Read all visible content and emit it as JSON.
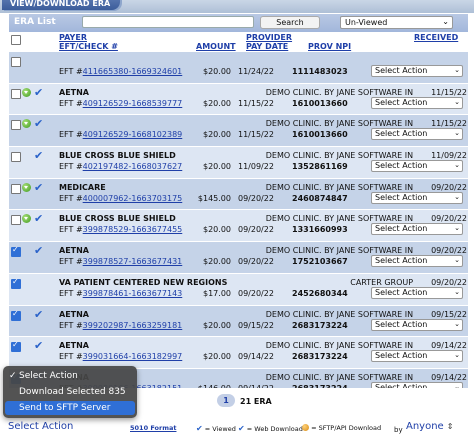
{
  "window": {
    "title": "VIEW/DOWNLOAD ERA"
  },
  "header": {
    "section_title": "ERA List",
    "search_value": "",
    "search_button": "Search",
    "filter_value": "Un-Viewed"
  },
  "columns": {
    "payer": "PAYER",
    "eft": "EFT/CHECK #",
    "amount": "AMOUNT",
    "provider": "PROVIDER",
    "pay_date": "PAY DATE",
    "npi": "PROV NPI",
    "received": "RECEIVED"
  },
  "rows": [
    {
      "payer": "",
      "eft_prefix": "EFT #",
      "eft": "411665380-1669324601",
      "amount": "$20.00",
      "pay_date": "11/24/22",
      "provider": "",
      "npi": "1111483023",
      "received": "",
      "action": "Select Action",
      "checked": false,
      "downloaded": false,
      "viewed": false
    },
    {
      "payer": "AETNA",
      "eft_prefix": "EFT #",
      "eft": "409126529-1668539777",
      "amount": "$20.00",
      "pay_date": "11/15/22",
      "provider": "DEMO CLINIC. BY JANE SOFTWARE IN",
      "npi": "1610013660",
      "received": "11/15/22",
      "action": "Select Action",
      "checked": false,
      "downloaded": true,
      "viewed": true
    },
    {
      "payer": "",
      "eft_prefix": "EFT #",
      "eft": "409126529-1668102389",
      "amount": "$20.00",
      "pay_date": "11/15/22",
      "provider": "DEMO CLINIC. BY JANE SOFTWARE IN",
      "npi": "1610013660",
      "received": "11/15/22",
      "action": "Select Action",
      "checked": false,
      "downloaded": true,
      "viewed": true
    },
    {
      "payer": "BLUE CROSS BLUE SHIELD",
      "eft_prefix": "EFT #",
      "eft": "402197482-1668037627",
      "amount": "$20.00",
      "pay_date": "11/09/22",
      "provider": "DEMO CLINIC. BY JANE SOFTWARE IN",
      "npi": "1352861169",
      "received": "11/09/22",
      "action": "Select Action",
      "checked": false,
      "downloaded": false,
      "viewed": true
    },
    {
      "payer": "MEDICARE",
      "eft_prefix": "EFT #",
      "eft": "400007962-1663703175",
      "amount": "$145.00",
      "pay_date": "09/20/22",
      "provider": "DEMO CLINIC. BY JANE SOFTWARE IN",
      "npi": "2460874847",
      "received": "09/20/22",
      "action": "Select Action",
      "checked": false,
      "downloaded": true,
      "viewed": true
    },
    {
      "payer": "BLUE CROSS BLUE SHIELD",
      "eft_prefix": "EFT #",
      "eft": "399878529-1663677455",
      "amount": "$20.00",
      "pay_date": "09/20/22",
      "provider": "DEMO CLINIC. BY JANE SOFTWARE IN",
      "npi": "1331660993",
      "received": "09/20/22",
      "action": "Select Action",
      "checked": false,
      "downloaded": true,
      "viewed": true
    },
    {
      "payer": "AETNA",
      "eft_prefix": "EFT #",
      "eft": "399878527-1663677431",
      "amount": "$20.00",
      "pay_date": "09/20/22",
      "provider": "DEMO CLINIC. BY JANE SOFTWARE IN",
      "npi": "1752103667",
      "received": "09/20/22",
      "action": "Select Action",
      "checked": true,
      "downloaded": false,
      "viewed": true
    },
    {
      "payer": "VA PATIENT CENTERED NEW REGIONS",
      "eft_prefix": "EFT #",
      "eft": "399878461-1663677143",
      "amount": "$17.00",
      "pay_date": "09/20/22",
      "provider": "CARTER GROUP",
      "npi": "2452680344",
      "received": "09/20/22",
      "action": "Select Action",
      "checked": true,
      "downloaded": false,
      "viewed": false
    },
    {
      "payer": "AETNA",
      "eft_prefix": "EFT #",
      "eft": "399202987-1663259181",
      "amount": "$20.00",
      "pay_date": "09/15/22",
      "provider": "DEMO CLINIC. BY JANE SOFTWARE IN",
      "npi": "2683173224",
      "received": "09/15/22",
      "action": "Select Action",
      "checked": true,
      "downloaded": false,
      "viewed": true
    },
    {
      "payer": "AETNA",
      "eft_prefix": "EFT #",
      "eft": "399031664-1663182997",
      "amount": "$20.00",
      "pay_date": "09/14/22",
      "provider": "DEMO CLINIC. BY JANE SOFTWARE IN",
      "npi": "2683173224",
      "received": "09/14/22",
      "action": "Select Action",
      "checked": true,
      "downloaded": false,
      "viewed": true
    },
    {
      "payer": "AETNA",
      "eft_prefix": "EFT #",
      "eft": "399030166-1663182151",
      "amount": "$146.00",
      "pay_date": "09/14/22",
      "provider": "DEMO CLINIC. BY JANE SOFTWARE IN",
      "npi": "2683173224",
      "received": "09/14/22",
      "action": "Select Action",
      "checked": true,
      "downloaded": false,
      "viewed": true
    }
  ],
  "pager": {
    "current_page": "1",
    "summary": "21 ERA"
  },
  "bottom": {
    "action_value": "Select Action",
    "format_link": "5010 Format",
    "legend_viewed": "= Viewed",
    "legend_web": "= Web Download",
    "legend_sftp": "= SFTP/API Download",
    "by_label": "by",
    "by_value": "Anyone"
  },
  "popup": {
    "options": [
      "Select Action",
      "Download Selected 835",
      "Send to SFTP Server"
    ],
    "selected_index": 0,
    "highlighted_index": 2
  }
}
